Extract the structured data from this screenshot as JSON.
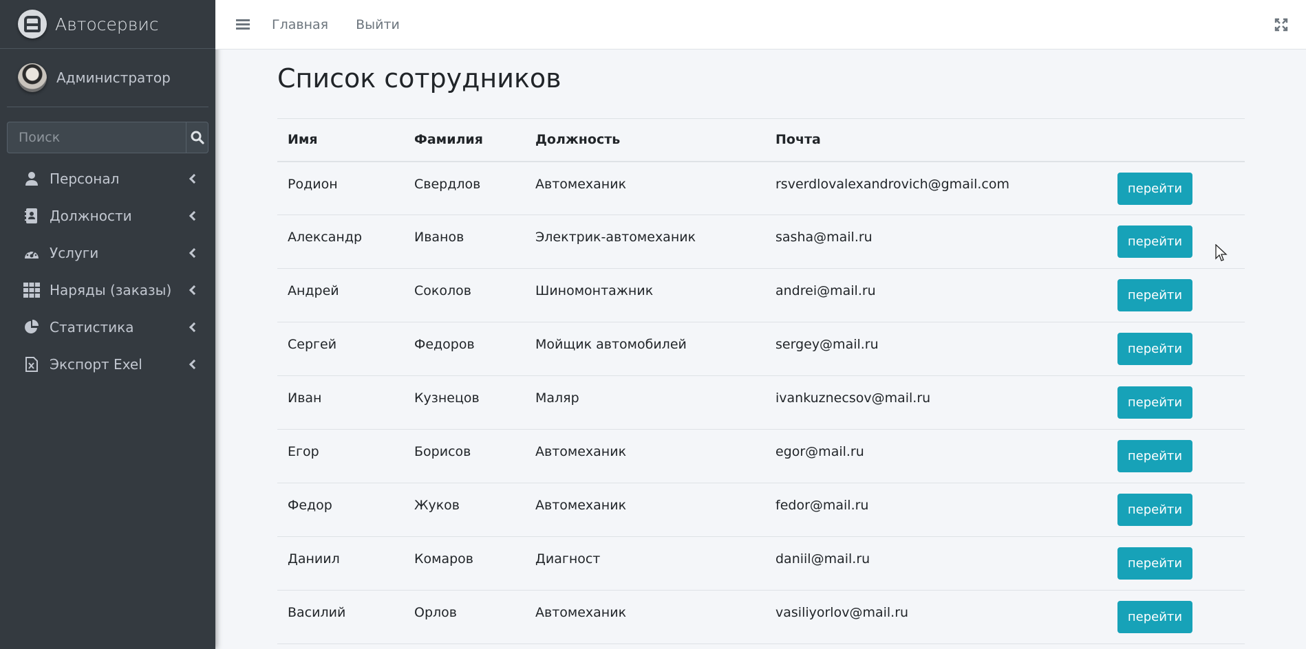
{
  "brand": {
    "title": "Автосервис"
  },
  "user": {
    "name": "Администратор"
  },
  "search": {
    "placeholder": "Поиск"
  },
  "nav": {
    "items": [
      {
        "label": "Персонал",
        "icon": "user-icon"
      },
      {
        "label": "Должности",
        "icon": "contact-book-icon"
      },
      {
        "label": "Услуги",
        "icon": "speedometer-icon"
      },
      {
        "label": "Наряды (заказы)",
        "icon": "grid-icon"
      },
      {
        "label": "Статистика",
        "icon": "pie-chart-icon"
      },
      {
        "label": "Экспорт Exel",
        "icon": "excel-file-icon"
      }
    ]
  },
  "topbar": {
    "home": "Главная",
    "logout": "Выйти"
  },
  "page": {
    "title": "Список сотрудников"
  },
  "table": {
    "headers": [
      "Имя",
      "Фамилия",
      "Должность",
      "Почта",
      ""
    ],
    "button_label": "перейти",
    "rows": [
      [
        "Родион",
        "Свердлов",
        "Автомеханик",
        "rsverdlovalexandrovich@gmail.com"
      ],
      [
        "Александр",
        "Иванов",
        "Электрик-автомеханик",
        "sasha@mail.ru"
      ],
      [
        "Андрей",
        "Соколов",
        "Шиномонтажник",
        "andrei@mail.ru"
      ],
      [
        "Сергей",
        "Федоров",
        "Мойщик автомобилей",
        "sergey@mail.ru"
      ],
      [
        "Иван",
        "Кузнецов",
        "Маляр",
        "ivankuznecsov@mail.ru"
      ],
      [
        "Егор",
        "Борисов",
        "Автомеханик",
        "egor@mail.ru"
      ],
      [
        "Федор",
        "Жуков",
        "Автомеханик",
        "fedor@mail.ru"
      ],
      [
        "Даниил",
        "Комаров",
        "Диагност",
        "daniil@mail.ru"
      ],
      [
        "Василий",
        "Орлов",
        "Автомеханик",
        "vasiliyorlov@mail.ru"
      ]
    ]
  },
  "colors": {
    "sidebar": "#343a40",
    "accent": "#17a2b8",
    "background": "#f4f6f9"
  }
}
